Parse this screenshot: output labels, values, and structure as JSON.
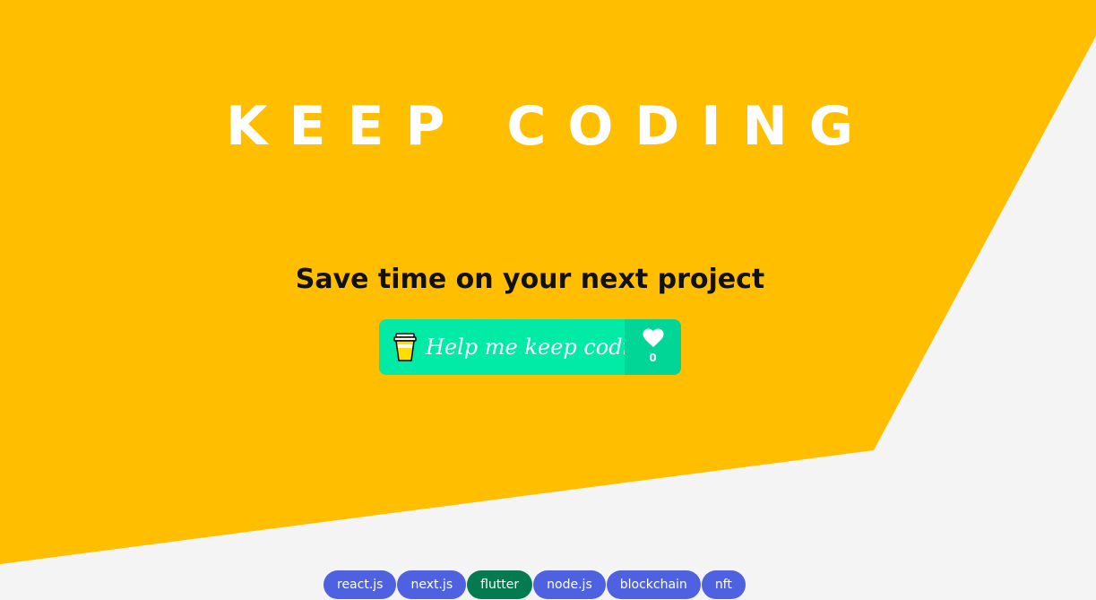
{
  "hero": {
    "headline": "KEEP CODING",
    "subheadline": "Save time on your next project",
    "background_color": "#ffbf00"
  },
  "support_button": {
    "label": "Help me keep coding",
    "like_count": "0",
    "cup_icon": "coffee-cup-icon",
    "like_icon": "heart-icon",
    "main_color": "#01eaa6"
  },
  "tags": {
    "items": [
      "react.js",
      "next.js",
      "flutter",
      "node.js",
      "blockchain",
      "nft"
    ],
    "active": "flutter",
    "default_color": "#4e61e0",
    "active_color": "#047a50"
  }
}
